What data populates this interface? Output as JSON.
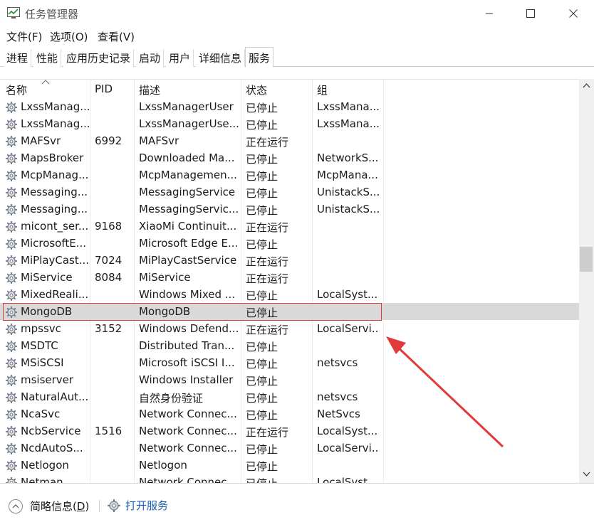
{
  "window": {
    "title": "任务管理器"
  },
  "menu": [
    "文件(F)",
    "选项(O)",
    "查看(V)"
  ],
  "tabs": [
    {
      "label": "进程",
      "active": false
    },
    {
      "label": "性能",
      "active": false
    },
    {
      "label": "应用历史记录",
      "active": false
    },
    {
      "label": "启动",
      "active": false
    },
    {
      "label": "用户",
      "active": false
    },
    {
      "label": "详细信息",
      "active": false
    },
    {
      "label": "服务",
      "active": true
    }
  ],
  "columns": {
    "name": "名称",
    "pid": "PID",
    "desc": "描述",
    "status": "状态",
    "group": "组"
  },
  "rows": [
    {
      "name": "LxssManag...",
      "pid": "",
      "desc": "LxssManagerUser",
      "status": "已停止",
      "group": "LxssMana..."
    },
    {
      "name": "LxssManag...",
      "pid": "",
      "desc": "LxssManagerUse...",
      "status": "已停止",
      "group": "LxssMana..."
    },
    {
      "name": "MAFSvr",
      "pid": "6992",
      "desc": "MAFSvr",
      "status": "正在运行",
      "group": ""
    },
    {
      "name": "MapsBroker",
      "pid": "",
      "desc": "Downloaded Ma...",
      "status": "已停止",
      "group": "NetworkS..."
    },
    {
      "name": "McpManag...",
      "pid": "",
      "desc": "McpManagemen...",
      "status": "已停止",
      "group": "McpMana..."
    },
    {
      "name": "Messaging...",
      "pid": "",
      "desc": "MessagingService",
      "status": "已停止",
      "group": "UnistackS..."
    },
    {
      "name": "Messaging...",
      "pid": "",
      "desc": "MessagingServic...",
      "status": "已停止",
      "group": "UnistackS..."
    },
    {
      "name": "micont_ser...",
      "pid": "9168",
      "desc": "XiaoMi Continuit...",
      "status": "正在运行",
      "group": ""
    },
    {
      "name": "MicrosoftE...",
      "pid": "",
      "desc": "Microsoft Edge E...",
      "status": "已停止",
      "group": ""
    },
    {
      "name": "MiPlayCast...",
      "pid": "7024",
      "desc": "MiPlayCastService",
      "status": "正在运行",
      "group": ""
    },
    {
      "name": "MiService",
      "pid": "8084",
      "desc": "MiService",
      "status": "正在运行",
      "group": ""
    },
    {
      "name": "MixedReali...",
      "pid": "",
      "desc": "Windows Mixed ...",
      "status": "已停止",
      "group": "LocalSyst..."
    },
    {
      "name": "MongoDB",
      "pid": "",
      "desc": "MongoDB",
      "status": "已停止",
      "group": "",
      "selected": true
    },
    {
      "name": "mpssvc",
      "pid": "3152",
      "desc": "Windows Defend...",
      "status": "正在运行",
      "group": "LocalServi..."
    },
    {
      "name": "MSDTC",
      "pid": "",
      "desc": "Distributed Tran...",
      "status": "已停止",
      "group": ""
    },
    {
      "name": "MSiSCSI",
      "pid": "",
      "desc": "Microsoft iSCSI I...",
      "status": "已停止",
      "group": "netsvcs"
    },
    {
      "name": "msiserver",
      "pid": "",
      "desc": "Windows Installer",
      "status": "已停止",
      "group": ""
    },
    {
      "name": "NaturalAut...",
      "pid": "",
      "desc": "自然身份验证",
      "status": "已停止",
      "group": "netsvcs"
    },
    {
      "name": "NcaSvc",
      "pid": "",
      "desc": "Network Connec...",
      "status": "已停止",
      "group": "NetSvcs"
    },
    {
      "name": "NcbService",
      "pid": "1516",
      "desc": "Network Connec...",
      "status": "正在运行",
      "group": "LocalSyst..."
    },
    {
      "name": "NcdAutoS...",
      "pid": "",
      "desc": "Network Connec...",
      "status": "已停止",
      "group": "LocalServi..."
    },
    {
      "name": "Netlogon",
      "pid": "",
      "desc": "Netlogon",
      "status": "已停止",
      "group": ""
    },
    {
      "name": "Netman",
      "pid": "",
      "desc": "Network Connec...",
      "status": "已停止",
      "group": "LocalSyst..."
    }
  ],
  "footer": {
    "fewer_details": "简略信息",
    "fewer_key": "D",
    "open_services": "打开服务"
  },
  "colors": {
    "annotation": "#e03a3a",
    "link": "#1a5fb4",
    "selected_row": "#d9d9d9"
  },
  "icons": {
    "app": "task-manager-icon",
    "service": "gear-icon"
  }
}
